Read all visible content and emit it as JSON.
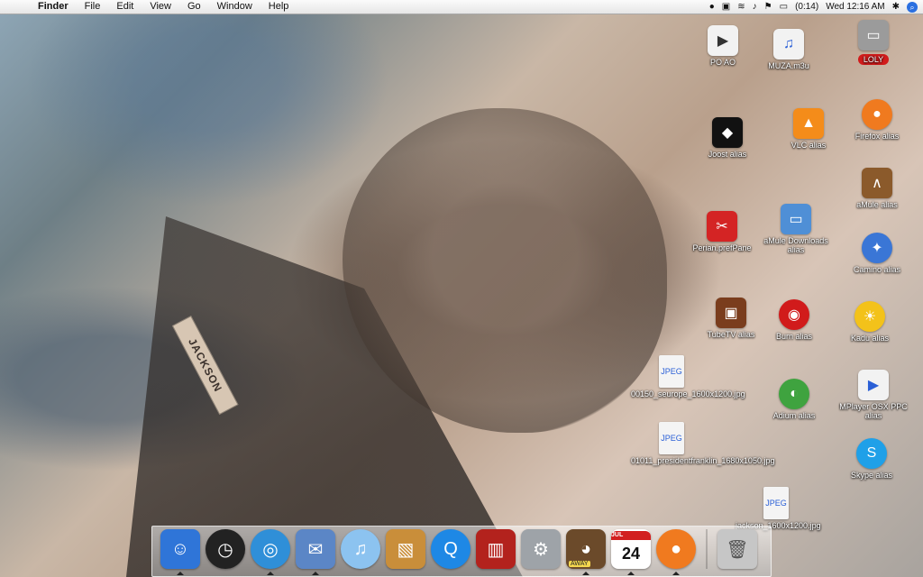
{
  "menubar": {
    "items": [
      "Finder",
      "File",
      "Edit",
      "View",
      "Go",
      "Window",
      "Help"
    ],
    "battery_time": "(0:14)",
    "clock": "Wed 12:16 AM"
  },
  "desktop_icons": {
    "poao": "PO AO",
    "muza": "MUZA.m3u",
    "loly": "LOLY",
    "joost": "Joost alias",
    "vlc": "VLC alias",
    "firefox": "Firefox alias",
    "amule": "aMule alias",
    "perian": "Perian.prefPane",
    "amule_downloads": "aMule Downloads alias",
    "camino": "Camino alias",
    "tubetv": "TubeTV alias",
    "burn": "Burn alias",
    "kadu": "Kadu alias",
    "jpeg1": "00150_seurope_1600x1200.jpg",
    "mplayer": "MPlayer OSX PPC alias",
    "adium": "Adium alias",
    "jpeg2": "01011_presidentfranklin_1680x1050.jpg",
    "skype": "Skype alias",
    "jpeg3": "jackson_1600x1200.jpg"
  },
  "wallpaper": {
    "tag_text": "JACKSON"
  },
  "dock": {
    "items": [
      {
        "name": "Finder",
        "icon": "finder-icon",
        "running": true
      },
      {
        "name": "Dashboard",
        "icon": "dashboard-icon",
        "running": false
      },
      {
        "name": "Safari",
        "icon": "safari-icon",
        "running": true
      },
      {
        "name": "Mail",
        "icon": "mail-icon",
        "running": true
      },
      {
        "name": "iTunes",
        "icon": "itunes-icon",
        "running": false
      },
      {
        "name": "iPhoto",
        "icon": "iphoto-icon",
        "running": false
      },
      {
        "name": "QuickTime",
        "icon": "quicktime-icon",
        "running": false
      },
      {
        "name": "Front Row",
        "icon": "frontrow-icon",
        "running": false
      },
      {
        "name": "System Preferences",
        "icon": "system-prefs-icon",
        "running": false
      },
      {
        "name": "Adium (AWAY)",
        "icon": "adium-away-icon",
        "running": true
      },
      {
        "name": "iCal",
        "icon": "ical-icon",
        "running": true
      },
      {
        "name": "Firefox",
        "icon": "firefox-icon",
        "running": true
      },
      {
        "name": "Trash",
        "icon": "trash-icon",
        "running": false
      }
    ],
    "calendar": {
      "month": "JUL",
      "day": "24"
    },
    "away_badge": "AWAY"
  },
  "colors": {
    "accent": "#2e6fe0",
    "menubar_bg": "#f1f1f1",
    "text": "#111111"
  }
}
